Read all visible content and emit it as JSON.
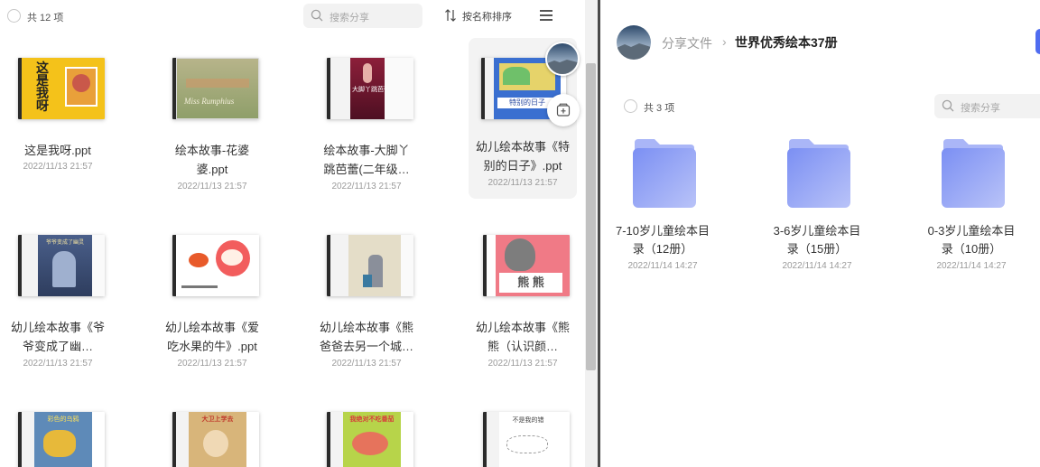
{
  "left": {
    "count_label": "共 12 项",
    "search_placeholder": "搜索分享",
    "sort_label": "按名称排序",
    "files": [
      {
        "name_line1": "这是我呀.ppt",
        "name_line2": "",
        "date": "2022/11/13 21:57",
        "cover_text": "这\n是\n我\n呀"
      },
      {
        "name_line1": "绘本故事-花婆",
        "name_line2": "婆.ppt",
        "date": "2022/11/13 21:57",
        "cover_text": "Miss Rumphius"
      },
      {
        "name_line1": "绘本故事-大脚丫",
        "name_line2": "跳芭蕾(二年级…",
        "date": "2022/11/13 21:57",
        "cover_text": "大脚丫跳芭蕾"
      },
      {
        "name_line1": "幼儿绘本故事《特",
        "name_line2": "别的日子》.ppt",
        "date": "2022/11/13 21:57",
        "cover_text": "特别的日子"
      },
      {
        "name_line1": "幼儿绘本故事《爷",
        "name_line2": "爷变成了幽…",
        "date": "2022/11/13 21:57",
        "cover_text": "爷爷变成了幽灵"
      },
      {
        "name_line1": "幼儿绘本故事《爱",
        "name_line2": "吃水果的牛》.ppt",
        "date": "2022/11/13 21:57",
        "cover_text": ""
      },
      {
        "name_line1": "幼儿绘本故事《熊",
        "name_line2": "爸爸去另一个城…",
        "date": "2022/11/13 21:57",
        "cover_text": ""
      },
      {
        "name_line1": "幼儿绘本故事《熊",
        "name_line2": "熊（认识颜…",
        "date": "2022/11/13 21:57",
        "cover_text": "熊 熊"
      },
      {
        "name_line1": "",
        "name_line2": "",
        "date": "",
        "cover_text": "彩色的乌鸦"
      },
      {
        "name_line1": "",
        "name_line2": "",
        "date": "",
        "cover_text": "大卫上学去"
      },
      {
        "name_line1": "",
        "name_line2": "",
        "date": "",
        "cover_text": "我绝对不吃番茄"
      },
      {
        "name_line1": "",
        "name_line2": "",
        "date": "",
        "cover_text": "不是我的错"
      }
    ]
  },
  "right": {
    "breadcrumb_root": "分享文件",
    "breadcrumb_sep": "›",
    "breadcrumb_current": "世界优秀绘本37册",
    "count_label": "共 3 项",
    "search_placeholder": "搜索分享",
    "folders": [
      {
        "name_line1": "7-10岁儿童绘本目",
        "name_line2": "录（12册）",
        "date": "2022/11/14 14:27"
      },
      {
        "name_line1": "3-6岁儿童绘本目",
        "name_line2": "录（15册）",
        "date": "2022/11/14 14:27"
      },
      {
        "name_line1": "0-3岁儿童绘本目",
        "name_line2": "录（10册）",
        "date": "2022/11/14 14:27"
      }
    ]
  },
  "icons": {
    "search": "search-icon",
    "sort": "sort-icon",
    "menu": "menu-icon",
    "save": "save-to-drive-icon",
    "folder": "folder-icon"
  },
  "colors": {
    "accent": "#4f6cf0",
    "folder_front": "#8c9df5",
    "folder_back": "#a9b6f7"
  }
}
